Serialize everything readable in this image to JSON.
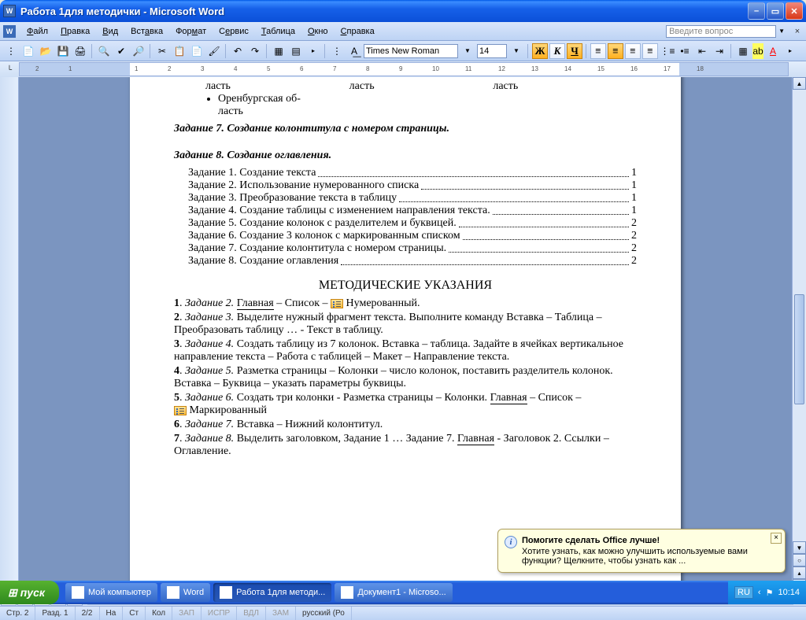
{
  "window": {
    "title": "Работа 1для методички - Microsoft Word"
  },
  "menu": {
    "items": [
      "Файл",
      "Правка",
      "Вид",
      "Вставка",
      "Формат",
      "Сервис",
      "Таблица",
      "Окно",
      "Справка"
    ],
    "help_placeholder": "Введите вопрос"
  },
  "format": {
    "font_name": "Times New Roman",
    "font_size": "14",
    "bold": "Ж",
    "italic": "К",
    "underline": "Ч"
  },
  "ruler": {
    "ticks": [
      "2",
      "1",
      "",
      "1",
      "2",
      "3",
      "4",
      "5",
      "6",
      "7",
      "8",
      "9",
      "10",
      "11",
      "12",
      "13",
      "14",
      "15",
      "16",
      "17",
      "18"
    ]
  },
  "doc": {
    "cut_top": [
      "ласть",
      "ласть",
      "ласть"
    ],
    "bullet": "Оренбургская об-\nласть",
    "task7": "Задание 7. Создание колонтитула с номером страницы.",
    "task8": "Задание 8. Создание оглавления.",
    "toc": [
      {
        "t": "Задание 1. Создание текста",
        "p": "1"
      },
      {
        "t": "Задание 2. Использование нумерованного списка",
        "p": "1"
      },
      {
        "t": "Задание 3. Преобразование текста в таблицу",
        "p": "1"
      },
      {
        "t": "Задание 4. Создание таблицы с изменением направления текста.",
        "p": "1"
      },
      {
        "t": "Задание 5. Создание колонок с разделителем и буквицей.",
        "p": "2"
      },
      {
        "t": "Задание 6. Создание 3 колонок с маркированным списком",
        "p": "2"
      },
      {
        "t": "Задание 7. Создание колонтитула с номером страницы.",
        "p": "2"
      },
      {
        "t": "Задание 8. Создание оглавления",
        "p": "2"
      }
    ],
    "mu_title": "МЕТОДИЧЕСКИЕ УКАЗАНИЯ",
    "mu": {
      "l1a": "Задание 2.",
      "l1b": "Главная",
      "l1c": " – Список – ",
      "l1d": " Нумерованный.",
      "l2a": "Задание 3.",
      "l2b": " Выделите нужный фрагмент текста. Выполните команду Вставка – Таблица – Преобразовать таблицу … -  Текст в таблицу.",
      "l3a": "Задание 4.",
      "l3b": " Создать таблицу из 7 колонок. Вставка – таблица. Задайте в ячейках вертикальное направление текста – Работа с таблицей – Макет – Направление текста.",
      "l4a": "Задание 5.",
      "l4b": " Разметка страницы – Колонки – число колонок, поставить разделитель колонок. Вставка – Буквица – указать параметры буквицы.",
      "l5a": "Задание 6.",
      "l5b": " Создать три колонки - Разметка страницы – Колонки. ",
      "l5c": "Главная",
      "l5d": " – Список – ",
      "l5e": " Маркированный",
      "l6a": "Задание 7.",
      "l6b": " Вставка – Нижний колонтитул.",
      "l7a": "Задание 8.",
      "l7b": " Выделить заголовком, Задание 1 … Задание 7. ",
      "l7c": "Главная",
      "l7d": " - Заголовок 2. Ссылки – Оглавление."
    }
  },
  "balloon": {
    "title": "Помогите сделать Office лучше!",
    "body": "Хотите узнать, как можно улучшить используемые вами функции?  Щелкните, чтобы узнать как ..."
  },
  "status": {
    "page": "Стр. 2",
    "sect": "Разд. 1",
    "pages": "2/2",
    "at": "На",
    "line": "Ст",
    "col": "Кол",
    "rec": "ЗАП",
    "trk": "ИСПР",
    "ext": "ВДЛ",
    "ovr": "ЗАМ",
    "lang": "русский (Ро"
  },
  "taskbar": {
    "start": "пуск",
    "items": [
      {
        "label": "Мой компьютер",
        "cls": ""
      },
      {
        "label": "Word",
        "cls": ""
      },
      {
        "label": "Работа 1для методи...",
        "cls": "active"
      },
      {
        "label": "Документ1 - Microso...",
        "cls": ""
      }
    ],
    "lang": "RU",
    "time": "10:14"
  }
}
